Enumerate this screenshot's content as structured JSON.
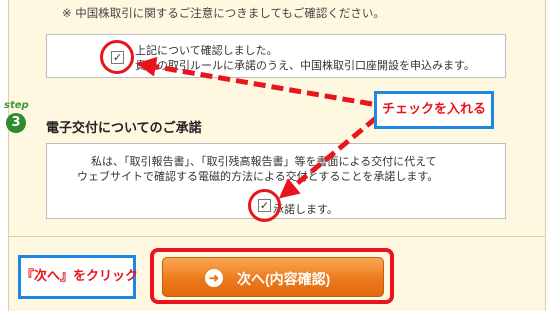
{
  "notice": "※ 中国株取引に関するご注意につきましてもご確認ください。",
  "confirm1": {
    "line1": "上記について確認しました。",
    "line2": "貴社の取引ルールに承諾のうえ、中国株取引口座開設を申込みます。",
    "checked": true
  },
  "step": {
    "label": "step",
    "number": "3"
  },
  "section_title": "電子交付についてのご承諾",
  "confirm2": {
    "line1": "私は、「取引報告書」、「取引残高報告書」等を書面による交付に代えて",
    "line2": "ウェブサイトで確認する電磁的方法による交付とすることを承諾します。",
    "check_label": "承諾します。",
    "checked": true
  },
  "callouts": {
    "check": "チェックを入れる",
    "next": "『次へ』をクリック"
  },
  "next_button": {
    "icon": "➜",
    "label": "次へ(内容確認)"
  },
  "colors": {
    "highlight_red": "#e8151c",
    "callout_border_blue": "#1e88e5",
    "button_orange": "#ee7a1c",
    "panel_bg": "#fff8e1",
    "step_green": "#2e8b2e"
  }
}
